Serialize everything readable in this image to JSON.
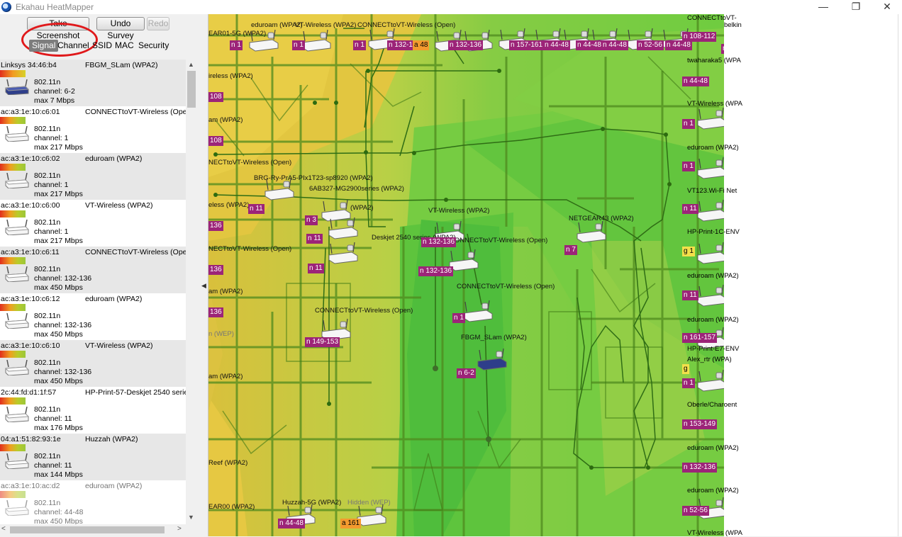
{
  "window": {
    "title": "Ekahau HeatMapper",
    "min_label": "—",
    "restore_label": "❐",
    "close_label": "✕"
  },
  "toolbar": {
    "take_screenshot": "Take Screenshot",
    "undo_survey": "Undo Survey",
    "redo": "Redo"
  },
  "tabs": [
    "Signal",
    "Channel",
    "SSID",
    "MAC",
    "Security"
  ],
  "access_points": [
    {
      "mac": "Linksys 34:46:b4",
      "ssid": "FBGM_SLam (WPA2)",
      "std": "802.11n",
      "channel": "channel: 6-2",
      "max": "max 7 Mbps"
    },
    {
      "mac": "ac:a3:1e:10:c6:01",
      "ssid": "CONNECTtoVT-Wireless (Open)",
      "std": "802.11n",
      "channel": "channel: 1",
      "max": "max 217 Mbps"
    },
    {
      "mac": "ac:a3:1e:10:c6:02",
      "ssid": "eduroam (WPA2)",
      "std": "802.11n",
      "channel": "channel: 1",
      "max": "max 217 Mbps"
    },
    {
      "mac": "ac:a3:1e:10:c6:00",
      "ssid": "VT-Wireless (WPA2)",
      "std": "802.11n",
      "channel": "channel: 1",
      "max": "max 217 Mbps"
    },
    {
      "mac": "ac:a3:1e:10:c6:11",
      "ssid": "CONNECTtoVT-Wireless (Open)",
      "std": "802.11n",
      "channel": "channel: 132-136",
      "max": "max 450 Mbps"
    },
    {
      "mac": "ac:a3:1e:10:c6:12",
      "ssid": "eduroam (WPA2)",
      "std": "802.11n",
      "channel": "channel: 132-136",
      "max": "max 450 Mbps"
    },
    {
      "mac": "ac:a3:1e:10:c6:10",
      "ssid": "VT-Wireless (WPA2)",
      "std": "802.11n",
      "channel": "channel: 132-136",
      "max": "max 450 Mbps"
    },
    {
      "mac": "2c:44:fd:d1:1f:57",
      "ssid": "HP-Print-57-Deskjet 2540 series",
      "std": "802.11n",
      "channel": "channel: 11",
      "max": "max 176 Mbps"
    },
    {
      "mac": "04:a1:51:82:93:1e",
      "ssid": "Huzzah (WPA2)",
      "std": "802.11n",
      "channel": "channel: 11",
      "max": "max 144 Mbps"
    },
    {
      "mac": "ac:a3:1e:10:ac:d2",
      "ssid": "eduroam (WPA2)",
      "std": "802.11n",
      "channel": "channel: 44-48",
      "max": "max 450 Mbps"
    }
  ],
  "right_panel": [
    "CONNECTtoVT-",
    "belkin",
    "twaharaka5 (WPA",
    "VT-Wireless (WPA",
    "eduroam (WPA2)",
    "VT123.Wi-Fi Net",
    "HP-Print-1C-ENV",
    "eduroam (WPA2)",
    "eduroam (WPA2)",
    "HP-Print-E7-ENV",
    "Alex_rtr (WPA)",
    "Oberle/Charoent",
    "eduroam (WPA2)",
    "eduroam (WPA2)",
    "VT-Wireless (WPA"
  ],
  "map_labels": [
    "eduroam (WPA2)",
    "VT-Wireless (WPA2)",
    "CONNECTtoVT-Wireless (Open)",
    "EAR01-5G (WPA2)",
    "ireless (WPA2)",
    "am (WPA2)",
    "NECTtoVT-Wireless (Open)",
    "eless (WPA2)",
    "NECTtoVT-Wireless (Open)",
    "am (WPA2)",
    "n (WEP)",
    "am (WPA2)",
    "Reef (WPA2)",
    "EAR00 (WPA2)",
    "BRG-Ry-PrA5-PIx1T23-sp8920 (WPA2)",
    "6AB327-MG2900series (WPA2)",
    "(WPA2)",
    "Deskjet 2540 series (WPA2)",
    "VT-Wireless (WPA2)",
    "CONNECTtoVT-Wireless (Open)",
    "NETGEAR43 (WPA2)",
    "CONNECTtoVT-Wireless (Open)",
    "CONNECTtoVT-Wireless (Open)",
    "FBGM_SLam (WPA2)",
    "Huzzah-5G (WPA2)",
    "Hidden (WEP)"
  ],
  "map_chips": [
    "n 1",
    "n 1",
    "n 1",
    "n 132-1",
    "a 48",
    "n 132-136",
    "n 157-161",
    "n 44-48",
    "n 44-48",
    "n 44-48",
    "n 52-56",
    "n 44-48",
    "n 108-112",
    "n 1",
    "n 1",
    "n 11",
    "n 3",
    "n 11",
    "n 11",
    "n 132-136",
    "n 132-136",
    "n 149-153",
    "n 1",
    "n 6-2",
    "n 7",
    "n 44-48",
    "a 161",
    "n 44-48",
    "n 1",
    "n 1",
    "n 11",
    "g 1",
    "n 11",
    "n 161-157",
    "g",
    "n 1",
    "n 153-149",
    "n 132-136",
    "n 52-56",
    "108",
    "108",
    "136",
    "136",
    "136"
  ]
}
